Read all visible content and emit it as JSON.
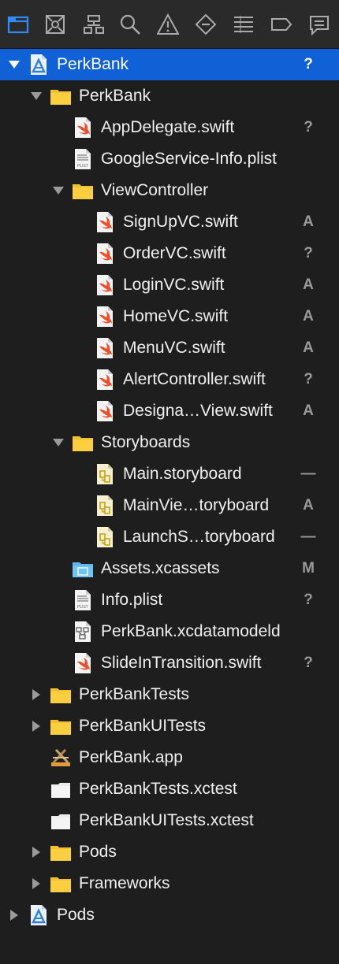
{
  "toolbar": {
    "icons": [
      {
        "name": "project-navigator-icon",
        "active": true
      },
      {
        "name": "source-control-navigator-icon"
      },
      {
        "name": "symbol-navigator-icon"
      },
      {
        "name": "find-navigator-icon"
      },
      {
        "name": "issue-navigator-icon"
      },
      {
        "name": "test-navigator-icon"
      },
      {
        "name": "debug-navigator-icon"
      },
      {
        "name": "breakpoint-navigator-icon"
      },
      {
        "name": "report-navigator-icon"
      }
    ]
  },
  "accent_color": "#1061d6",
  "tree": [
    {
      "label": "PerkBank",
      "icon": "xcode-project-icon",
      "disclosure": "expanded",
      "status": "?",
      "selected": true
    },
    {
      "label": "PerkBank",
      "icon": "folder-icon",
      "disclosure": "expanded",
      "status": ""
    },
    {
      "label": "AppDelegate.swift",
      "icon": "swift-file-icon",
      "disclosure": "none",
      "status": "?"
    },
    {
      "label": "GoogleService-Info.plist",
      "icon": "plist-file-icon",
      "disclosure": "none",
      "status": ""
    },
    {
      "label": "ViewController",
      "icon": "folder-icon",
      "disclosure": "expanded",
      "status": ""
    },
    {
      "label": "SignUpVC.swift",
      "icon": "swift-file-icon",
      "disclosure": "none",
      "status": "A"
    },
    {
      "label": "OrderVC.swift",
      "icon": "swift-file-icon",
      "disclosure": "none",
      "status": "?"
    },
    {
      "label": "LoginVC.swift",
      "icon": "swift-file-icon",
      "disclosure": "none",
      "status": "A"
    },
    {
      "label": "HomeVC.swift",
      "icon": "swift-file-icon",
      "disclosure": "none",
      "status": "A"
    },
    {
      "label": "MenuVC.swift",
      "icon": "swift-file-icon",
      "disclosure": "none",
      "status": "A"
    },
    {
      "label": "AlertController.swift",
      "icon": "swift-file-icon",
      "disclosure": "none",
      "status": "?"
    },
    {
      "label": "Designa…View.swift",
      "icon": "swift-file-icon",
      "disclosure": "none",
      "status": "A"
    },
    {
      "label": "Storyboards",
      "icon": "folder-icon",
      "disclosure": "expanded",
      "status": ""
    },
    {
      "label": "Main.storyboard",
      "icon": "storyboard-file-icon",
      "disclosure": "none",
      "status": "—"
    },
    {
      "label": "MainVie…toryboard",
      "icon": "storyboard-file-icon",
      "disclosure": "none",
      "status": "A"
    },
    {
      "label": "LaunchS…toryboard",
      "icon": "storyboard-file-icon",
      "disclosure": "none",
      "status": "—"
    },
    {
      "label": "Assets.xcassets",
      "icon": "asset-catalog-icon",
      "disclosure": "none",
      "status": "M"
    },
    {
      "label": "Info.plist",
      "icon": "plist-file-icon",
      "disclosure": "none",
      "status": "?"
    },
    {
      "label": "PerkBank.xcdatamodeld",
      "icon": "data-model-icon",
      "disclosure": "none",
      "status": ""
    },
    {
      "label": "SlideInTransition.swift",
      "icon": "swift-file-icon",
      "disclosure": "none",
      "status": "?"
    },
    {
      "label": "PerkBankTests",
      "icon": "folder-icon",
      "disclosure": "collapsed",
      "status": ""
    },
    {
      "label": "PerkBankUITests",
      "icon": "folder-icon",
      "disclosure": "collapsed",
      "status": ""
    },
    {
      "label": "PerkBank.app",
      "icon": "app-product-icon",
      "disclosure": "none",
      "status": ""
    },
    {
      "label": "PerkBankTests.xctest",
      "icon": "xctest-bundle-icon",
      "disclosure": "none",
      "status": ""
    },
    {
      "label": "PerkBankUITests.xctest",
      "icon": "xctest-bundle-icon",
      "disclosure": "none",
      "status": ""
    },
    {
      "label": "Pods",
      "icon": "folder-icon",
      "disclosure": "collapsed",
      "status": ""
    },
    {
      "label": "Frameworks",
      "icon": "folder-icon",
      "disclosure": "collapsed",
      "status": ""
    },
    {
      "label": "Pods",
      "icon": "xcode-project-icon",
      "disclosure": "collapsed",
      "status": ""
    }
  ]
}
